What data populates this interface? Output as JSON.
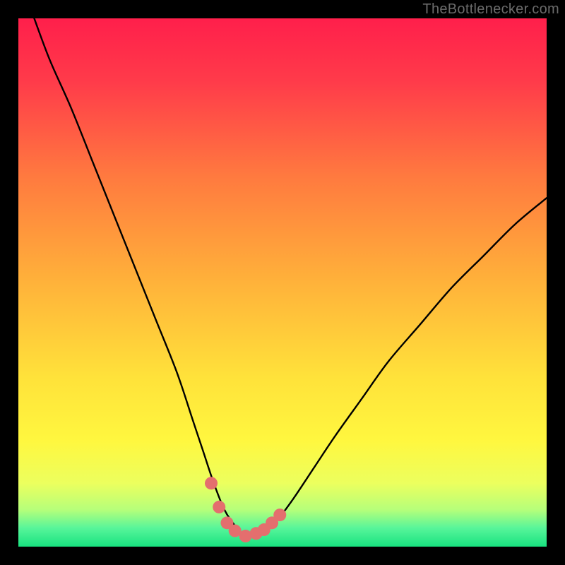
{
  "watermark": "TheBottlenecker.com",
  "colors": {
    "frame": "#000000",
    "curve": "#000000",
    "marker_fill": "#e46e6e",
    "marker_stroke": "#c95b5b",
    "gradient_stops": [
      {
        "offset": 0.0,
        "color": "#ff1f4b"
      },
      {
        "offset": 0.12,
        "color": "#ff3b4a"
      },
      {
        "offset": 0.3,
        "color": "#ff7a3f"
      },
      {
        "offset": 0.5,
        "color": "#ffb23a"
      },
      {
        "offset": 0.68,
        "color": "#ffe23a"
      },
      {
        "offset": 0.8,
        "color": "#fff73f"
      },
      {
        "offset": 0.88,
        "color": "#ecff5e"
      },
      {
        "offset": 0.93,
        "color": "#b6ff7a"
      },
      {
        "offset": 0.965,
        "color": "#57f59a"
      },
      {
        "offset": 1.0,
        "color": "#18e27f"
      }
    ]
  },
  "chart_data": {
    "type": "line",
    "title": "",
    "xlabel": "",
    "ylabel": "",
    "xlim": [
      0,
      100
    ],
    "ylim": [
      0,
      100
    ],
    "series": [
      {
        "name": "bottleneck-curve",
        "x": [
          3,
          6,
          10,
          14,
          18,
          22,
          26,
          30,
          33,
          35,
          37,
          39,
          41,
          43,
          45,
          47,
          49,
          52,
          56,
          60,
          65,
          70,
          76,
          82,
          88,
          94,
          100
        ],
        "y": [
          100,
          92,
          83,
          73,
          63,
          53,
          43,
          33,
          24,
          18,
          12,
          7,
          4,
          2,
          2,
          3,
          5,
          9,
          15,
          21,
          28,
          35,
          42,
          49,
          55,
          61,
          66
        ]
      }
    ],
    "markers": {
      "name": "highlight-dots",
      "x": [
        36.5,
        38.0,
        39.5,
        41.0,
        43.0,
        45.0,
        46.5,
        48.0,
        49.5
      ],
      "y": [
        12.0,
        7.5,
        4.5,
        3.0,
        2.0,
        2.5,
        3.2,
        4.5,
        6.0
      ],
      "r": 9
    }
  }
}
